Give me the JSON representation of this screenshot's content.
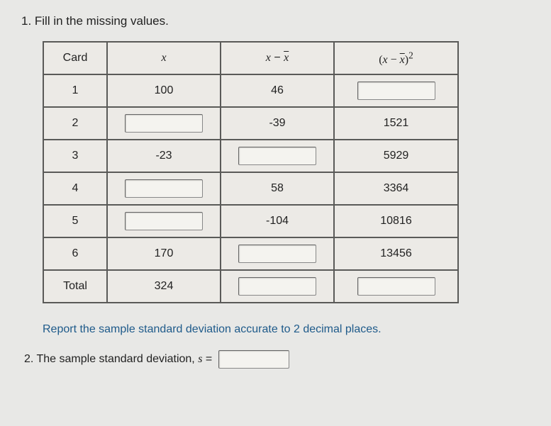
{
  "q1_label": "1. Fill in the missing values.",
  "headers": {
    "card": "Card",
    "x": "x",
    "dev_left": "x",
    "dev_minus": " − ",
    "dev_xbar": "x",
    "sq_open": "(",
    "sq_left": "x",
    "sq_minus": " − ",
    "sq_xbar": "x",
    "sq_close": ")",
    "sq_exp": "2"
  },
  "rows": [
    {
      "card": "1",
      "x": "100",
      "dev": "46",
      "sq": "",
      "x_input": false,
      "dev_input": false,
      "sq_input": true
    },
    {
      "card": "2",
      "x": "",
      "dev": "-39",
      "sq": "1521",
      "x_input": true,
      "dev_input": false,
      "sq_input": false
    },
    {
      "card": "3",
      "x": "-23",
      "dev": "",
      "sq": "5929",
      "x_input": false,
      "dev_input": true,
      "sq_input": false
    },
    {
      "card": "4",
      "x": "",
      "dev": "58",
      "sq": "3364",
      "x_input": true,
      "dev_input": false,
      "sq_input": false
    },
    {
      "card": "5",
      "x": "",
      "dev": "-104",
      "sq": "10816",
      "x_input": true,
      "dev_input": false,
      "sq_input": false
    },
    {
      "card": "6",
      "x": "170",
      "dev": "",
      "sq": "13456",
      "x_input": false,
      "dev_input": true,
      "sq_input": false
    }
  ],
  "total": {
    "label": "Total",
    "x": "324",
    "dev": "",
    "sq": "",
    "dev_input": true,
    "sq_input": true
  },
  "instruction": "Report the sample standard deviation accurate to 2 decimal places.",
  "q2_prefix": "2. The sample standard deviation, ",
  "q2_symbol": "s",
  "q2_eq": " ="
}
